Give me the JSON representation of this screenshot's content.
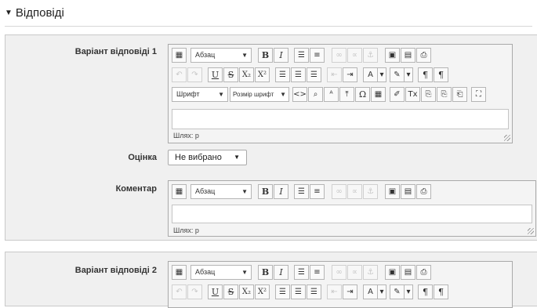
{
  "section": {
    "title": "Відповіді"
  },
  "answer1": {
    "label": "Варіант відповіді 1",
    "format": "Абзац",
    "font": "Шрифт",
    "font_size": "Розмір шрифт",
    "path": "Шлях: р"
  },
  "grade": {
    "label": "Оцінка",
    "value": "Не вибрано"
  },
  "comment": {
    "label": "Коментар",
    "format": "Абзац",
    "path": "Шлях: р"
  },
  "answer2": {
    "label": "Варіант відповіді 2",
    "format": "Абзац"
  },
  "toolbar": {
    "bold": "B",
    "italic": "I",
    "underline": "U",
    "strike": "S",
    "subscript": "X₂",
    "superscript": "X²",
    "special_char": "Ω",
    "code": "<>",
    "ltr": "¶",
    "rtl": "¶"
  }
}
